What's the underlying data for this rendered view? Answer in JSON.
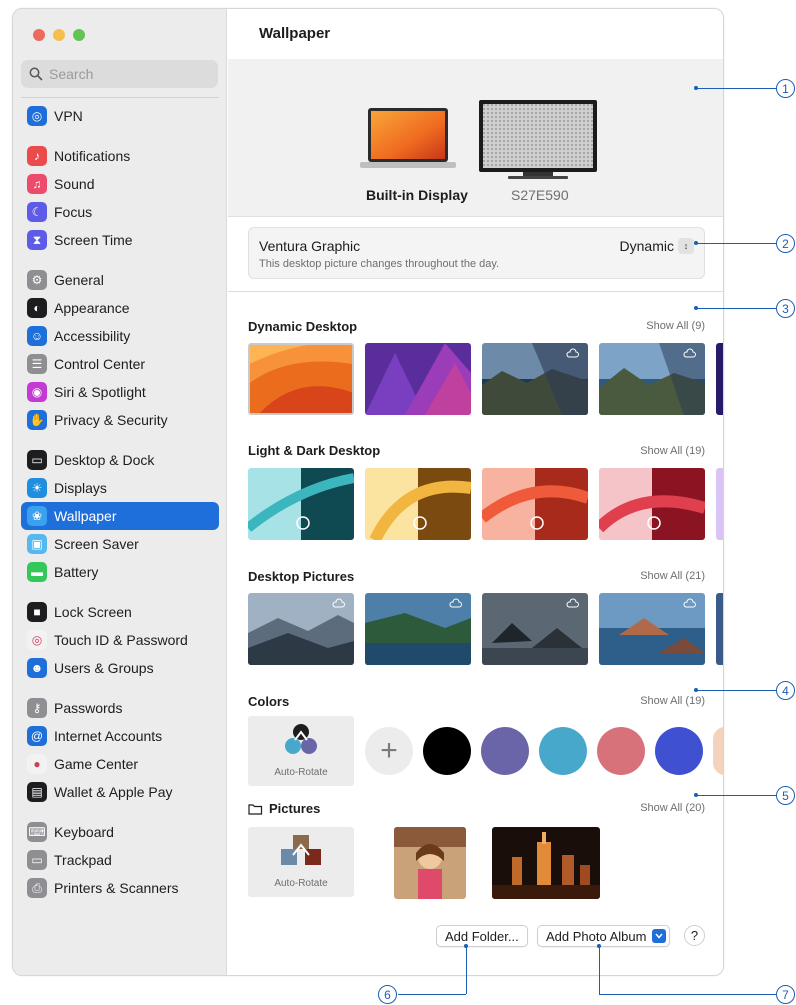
{
  "window": {
    "title": "Wallpaper"
  },
  "traffic_colors": [
    "#ed6a5e",
    "#f5bf4f",
    "#61c554"
  ],
  "search": {
    "placeholder": "Search"
  },
  "sidebar": {
    "groups": [
      [
        {
          "label": "VPN",
          "icon": "vpn-icon",
          "color": "#1f6fdb"
        }
      ],
      [
        {
          "label": "Notifications",
          "icon": "bell-icon",
          "color": "#ec4b4b"
        },
        {
          "label": "Sound",
          "icon": "speaker-icon",
          "color": "#ec4b6b"
        },
        {
          "label": "Focus",
          "icon": "moon-icon",
          "color": "#5e5ce6"
        },
        {
          "label": "Screen Time",
          "icon": "hourglass-icon",
          "color": "#5e5ce6"
        }
      ],
      [
        {
          "label": "General",
          "icon": "gear-icon",
          "color": "#8e8e93"
        },
        {
          "label": "Appearance",
          "icon": "appearance-icon",
          "color": "#1d1d1f"
        },
        {
          "label": "Accessibility",
          "icon": "accessibility-icon",
          "color": "#1f6fdb"
        },
        {
          "label": "Control Center",
          "icon": "control-center-icon",
          "color": "#8e8e93"
        },
        {
          "label": "Siri & Spotlight",
          "icon": "siri-icon",
          "color": "#c33bd3"
        },
        {
          "label": "Privacy & Security",
          "icon": "hand-icon",
          "color": "#1f6fdb"
        }
      ],
      [
        {
          "label": "Desktop & Dock",
          "icon": "dock-icon",
          "color": "#1d1d1f"
        },
        {
          "label": "Displays",
          "icon": "sun-icon",
          "color": "#1f8ee0"
        },
        {
          "label": "Wallpaper",
          "icon": "wallpaper-icon",
          "color": "#3aa1f0",
          "active": true
        },
        {
          "label": "Screen Saver",
          "icon": "screensaver-icon",
          "color": "#56b8f0"
        },
        {
          "label": "Battery",
          "icon": "battery-icon",
          "color": "#34c759"
        }
      ],
      [
        {
          "label": "Lock Screen",
          "icon": "lock-icon",
          "color": "#1d1d1f"
        },
        {
          "label": "Touch ID & Password",
          "icon": "fingerprint-icon",
          "color": "#f2f2f2"
        },
        {
          "label": "Users & Groups",
          "icon": "users-icon",
          "color": "#1f6fdb"
        }
      ],
      [
        {
          "label": "Passwords",
          "icon": "key-icon",
          "color": "#8e8e93"
        },
        {
          "label": "Internet Accounts",
          "icon": "at-icon",
          "color": "#1f6fdb"
        },
        {
          "label": "Game Center",
          "icon": "game-center-icon",
          "color": "#f2f2f2"
        },
        {
          "label": "Wallet & Apple Pay",
          "icon": "wallet-icon",
          "color": "#1d1d1f"
        }
      ],
      [
        {
          "label": "Keyboard",
          "icon": "keyboard-icon",
          "color": "#8e8e93"
        },
        {
          "label": "Trackpad",
          "icon": "trackpad-icon",
          "color": "#8e8e93"
        },
        {
          "label": "Printers & Scanners",
          "icon": "printer-icon",
          "color": "#8e8e93"
        }
      ]
    ]
  },
  "displays": {
    "builtin": "Built-in Display",
    "external": "S27E590"
  },
  "picker": {
    "name": "Ventura Graphic",
    "description": "This desktop picture changes throughout the day.",
    "value": "Dynamic"
  },
  "sections": {
    "dynamic": {
      "title": "Dynamic Desktop",
      "show_all": "Show All (9)"
    },
    "light_dark": {
      "title": "Light & Dark Desktop",
      "show_all": "Show All (19)"
    },
    "pictures": {
      "title": "Desktop Pictures",
      "show_all": "Show All (21)"
    },
    "colors": {
      "title": "Colors",
      "show_all": "Show All (19)",
      "auto_label": "Auto-Rotate",
      "swatches": [
        "#000000",
        "#6a65a8",
        "#48a8cc",
        "#d7717a",
        "#3f51d1",
        "#f5d2bd"
      ]
    },
    "folder": {
      "title": "Pictures",
      "show_all": "Show All (20)",
      "auto_label": "Auto-Rotate"
    }
  },
  "buttons": {
    "add_folder": "Add Folder...",
    "add_album": "Add Photo Album",
    "help": "?"
  },
  "callouts": [
    "1",
    "2",
    "3",
    "4",
    "5",
    "6",
    "7"
  ]
}
